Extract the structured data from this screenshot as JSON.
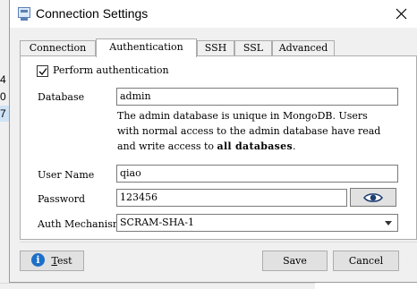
{
  "background": {
    "fragments": [
      "4",
      "0",
      "7"
    ]
  },
  "window": {
    "title": "Connection Settings"
  },
  "tabs": [
    {
      "label": "Connection"
    },
    {
      "label": "Authentication"
    },
    {
      "label": "SSH"
    },
    {
      "label": "SSL"
    },
    {
      "label": "Advanced"
    }
  ],
  "active_tab": "Authentication",
  "auth": {
    "perform_label": "Perform authentication",
    "perform_checked": true,
    "database_label": "Database",
    "database_value": "admin",
    "description_line1": "The admin database is unique in MongoDB. Users",
    "description_line2": "with normal access to the admin database have read",
    "description_line3_prefix": "and write access to ",
    "description_line3_bold": "all databases",
    "description_line3_suffix": ".",
    "username_label": "User Name",
    "username_value": "qiao",
    "password_label": "Password",
    "password_value": "123456",
    "mechanism_label": "Auth Mechanism",
    "mechanism_value": "SCRAM-SHA-1"
  },
  "buttons": {
    "test_underline": "T",
    "test_rest": "est",
    "save": "Save",
    "cancel": "Cancel"
  },
  "colors": {
    "info_icon": "#1d6fc8",
    "selection": "#cfe3f6"
  }
}
